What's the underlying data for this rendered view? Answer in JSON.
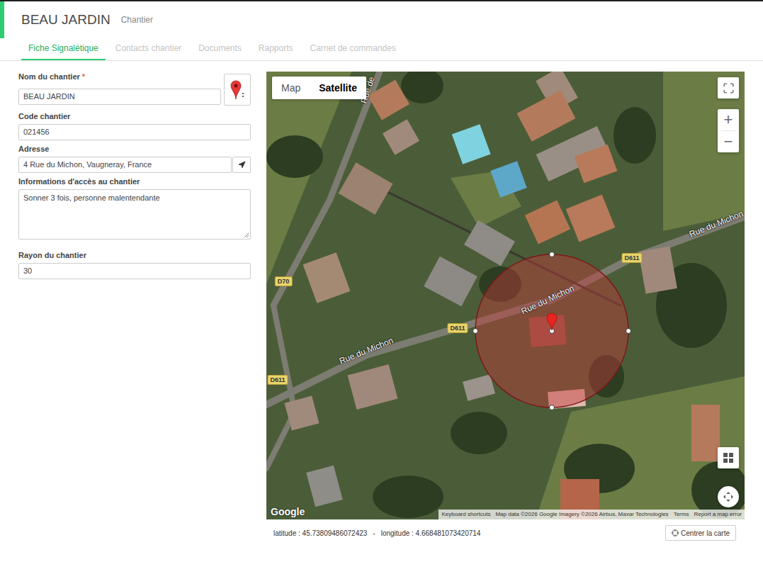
{
  "header": {
    "title": "BEAU JARDIN",
    "subtitle": "Chantier"
  },
  "tabs": [
    {
      "label": "Fiche Signalétique",
      "selected": true
    },
    {
      "label": "Contacts chantier",
      "selected": false
    },
    {
      "label": "Documents",
      "selected": false
    },
    {
      "label": "Rapports",
      "selected": false
    },
    {
      "label": "Carnet de commandes",
      "selected": false
    }
  ],
  "form": {
    "fields": [
      {
        "label": "Nom du chantier",
        "required": true,
        "required_mark": "*",
        "value": "BEAU JARDIN",
        "kind": "input-marker"
      },
      {
        "label": "Code chantier",
        "required": false,
        "value": "021456",
        "kind": "input"
      },
      {
        "label": "Adresse",
        "required": false,
        "value": "4 Rue du Michon, Vaugneray, France",
        "kind": "input-locate"
      },
      {
        "label": "Informations d'accès au chantier",
        "required": false,
        "value": "Sonner 3 fois, personne malentendante",
        "kind": "textarea"
      },
      {
        "label": "Rayon du chantier",
        "required": false,
        "value": "30",
        "kind": "input"
      }
    ]
  },
  "map": {
    "modes": [
      {
        "label": "Map",
        "selected": false
      },
      {
        "label": "Satellite",
        "selected": true
      }
    ],
    "zoom": [
      "+",
      "−"
    ],
    "labels": [
      {
        "text": "Rue de",
        "kind": "road"
      },
      {
        "text": "Rue du Michon",
        "kind": "road"
      },
      {
        "text": "Rue du Michon",
        "kind": "road"
      },
      {
        "text": "Rue du Michon",
        "kind": "road"
      },
      {
        "text": "D611",
        "kind": "shield"
      },
      {
        "text": "D611",
        "kind": "shield"
      },
      {
        "text": "D611",
        "kind": "shield"
      },
      {
        "text": "D70",
        "kind": "shield"
      }
    ],
    "logo": "Google",
    "attribution": [
      "Keyboard shortcuts",
      "Map data ©2026 Google Imagery ©2026 Airbus, Maxar Technologies",
      "Terms",
      "Report a map error"
    ]
  },
  "coords": {
    "latitude": "latitude : 45.73809486072423",
    "separator": "-",
    "longitude": "longitude : 4.668481073420714"
  },
  "center_button": "Centrer la carte"
}
